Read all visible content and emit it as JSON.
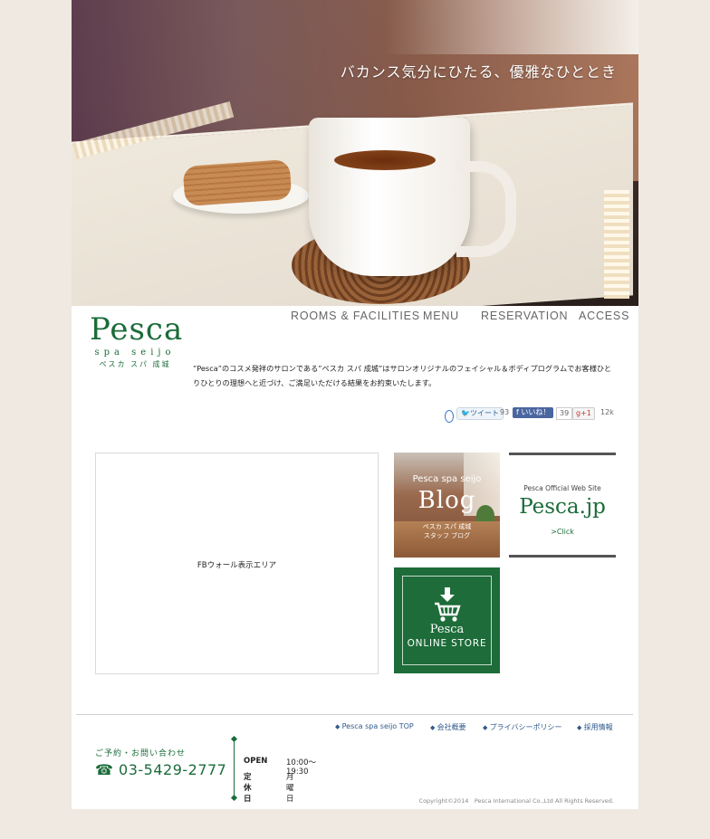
{
  "hero": {
    "caption": "バカンス気分にひたる、優雅なひととき"
  },
  "logo": {
    "word": "Pesca",
    "sub": "spa seijo",
    "kana": "ペスカ スパ 成城"
  },
  "nav": {
    "items": [
      "ROOMS & FACILITIES",
      "MENU",
      "RESERVATION",
      "ACCESS"
    ]
  },
  "intro": {
    "text": "”Pesca”のコスメ発祥のサロンである”ペスカ スパ 成城”はサロンオリジナルのフェイシャル＆ボディプログラムでお客様ひとりひとりの理想へと近づけ、ご満足いただける結果をお約束いたします。"
  },
  "social": {
    "tweet_label": "ツイート",
    "tweet_count": "93",
    "like_label": "いいね！",
    "like_count": "39",
    "gplus_label": "+1",
    "gplus_count": "12k"
  },
  "fbwall": {
    "label": "FBウォール表示エリア"
  },
  "blog": {
    "line1": "Pesca spa seijo",
    "title": "Blog",
    "line3": "ペスカ スパ 成城",
    "line4": "スタッフ ブログ"
  },
  "site": {
    "label": "Pesca Official Web Site",
    "title": "Pesca.jp",
    "click": ">Click"
  },
  "store": {
    "line1": "Pesca",
    "line2": "ONLINE STORE"
  },
  "footer": {
    "links": [
      "Pesca spa seijo TOP",
      "会社概要",
      "プライバシーポリシー",
      "採用情報"
    ],
    "contact_title": "ご予約・お問い合わせ",
    "phone": "03-5429-2777",
    "open_label": "OPEN",
    "open_value": "10:00〜19:30",
    "closed_label": "定休日",
    "closed_value": "月曜日",
    "copyright": "Copyright©2014　Pesca International Co.,Ltd All Rights Reserved."
  },
  "colors": {
    "brand_green": "#1b6c3a",
    "background": "#efe9e1",
    "link_blue": "#2f5a8c"
  }
}
